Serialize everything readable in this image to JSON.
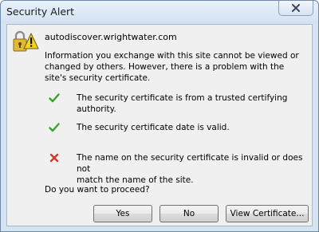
{
  "window": {
    "title": "Security Alert",
    "close_icon": "close-icon"
  },
  "dialog": {
    "host": "autodiscover.wrightwater.com",
    "info_line1": "Information you exchange with this site cannot be viewed or",
    "info_line2": "changed by others. However, there is a problem with the",
    "info_line3": "site's security certificate.",
    "checks": [
      {
        "status": "ok",
        "icon": "green-check-icon",
        "text": "The security certificate is from a trusted certifying authority."
      },
      {
        "status": "ok",
        "icon": "green-check-icon",
        "text": "The security certificate date is valid."
      },
      {
        "status": "error",
        "icon": "red-x-icon",
        "line1": "The name on the security certificate is invalid or does not",
        "line2": "match the name of the site."
      }
    ],
    "question": "Do you want to proceed?"
  },
  "buttons": {
    "yes": "Yes",
    "no": "No",
    "view_certificate": "View Certificate..."
  },
  "colors": {
    "check_green": "#3aa12f",
    "x_red": "#d23a2e",
    "warning_yellow": "#f5d21b"
  }
}
